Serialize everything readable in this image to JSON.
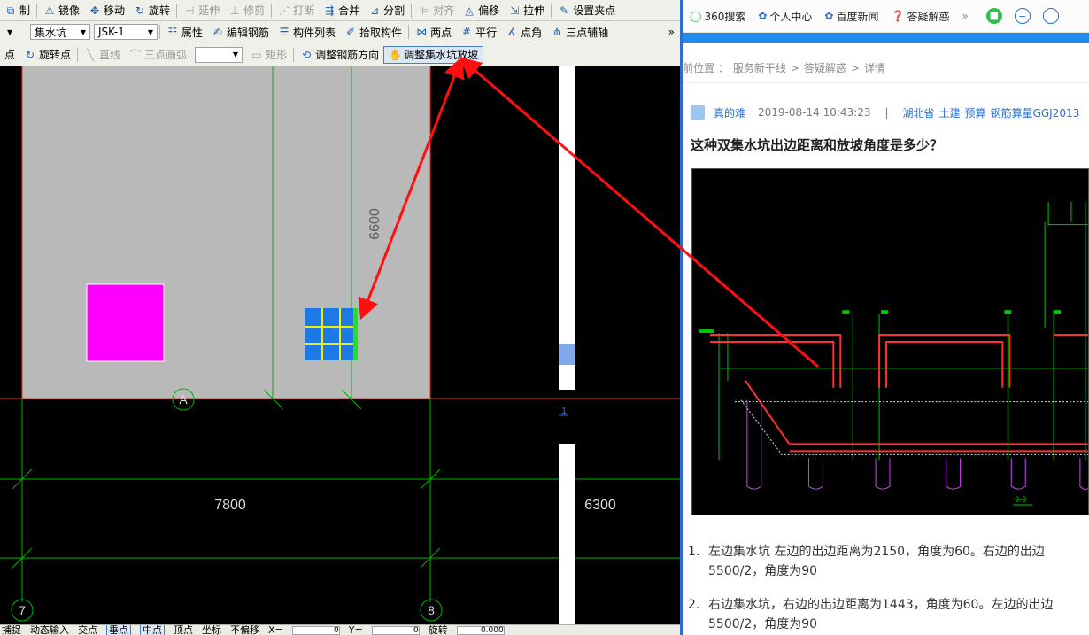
{
  "cad": {
    "toolbar1": {
      "items": [
        {
          "icon": "copy-icon",
          "glyph": "⧉",
          "label": "制",
          "disabled": false
        },
        {
          "icon": "mirror-icon",
          "glyph": "⚠",
          "label": "镜像",
          "disabled": false
        },
        {
          "icon": "move-icon",
          "glyph": "✥",
          "label": "移动",
          "disabled": false
        },
        {
          "icon": "rotate-icon",
          "glyph": "↻",
          "label": "旋转",
          "disabled": false
        },
        {
          "icon": "extend-icon",
          "glyph": "⊣",
          "label": "延伸",
          "disabled": true
        },
        {
          "icon": "trim-icon",
          "glyph": "⊥",
          "label": "修剪",
          "disabled": true
        },
        {
          "icon": "break-icon",
          "glyph": "⋰",
          "label": "打断",
          "disabled": true
        },
        {
          "icon": "merge-icon",
          "glyph": "⇶",
          "label": "合并",
          "disabled": false
        },
        {
          "icon": "split-icon",
          "glyph": "⊿",
          "label": "分割",
          "disabled": false
        },
        {
          "icon": "align-icon",
          "glyph": "⊫",
          "label": "对齐",
          "disabled": true
        },
        {
          "icon": "offset-icon",
          "glyph": "◬",
          "label": "偏移",
          "disabled": false
        },
        {
          "icon": "stretch-icon",
          "glyph": "⇲",
          "label": "拉伸",
          "disabled": false
        },
        {
          "icon": "grip-icon",
          "glyph": "✎",
          "label": "设置夹点",
          "disabled": false
        }
      ]
    },
    "toolbar2": {
      "category": "集水坑",
      "component": "JSK-1",
      "items": [
        {
          "icon": "properties-icon",
          "glyph": "☷",
          "label": "属性"
        },
        {
          "icon": "edit-rebar-icon",
          "glyph": "✍",
          "label": "编辑钢筋"
        },
        {
          "icon": "component-list-icon",
          "glyph": "☰",
          "label": "构件列表"
        },
        {
          "icon": "pick-component-icon",
          "glyph": "✐",
          "label": "拾取构件"
        },
        {
          "icon": "two-point-icon",
          "glyph": "⋈",
          "label": "两点"
        },
        {
          "icon": "parallel-icon",
          "glyph": "#",
          "label": "平行"
        },
        {
          "icon": "point-angle-icon",
          "glyph": "∡",
          "label": "点角"
        },
        {
          "icon": "three-point-aux-icon",
          "glyph": "⋔",
          "label": "三点辅轴"
        }
      ],
      "more": "»"
    },
    "toolbar3": {
      "items": [
        {
          "icon": "point-icon",
          "glyph": "",
          "label": "点",
          "disabled": false
        },
        {
          "icon": "rotate-point-icon",
          "glyph": "↻",
          "label": "旋转点",
          "disabled": false
        },
        {
          "icon": "line-icon",
          "glyph": "╲",
          "label": "直线",
          "disabled": true
        },
        {
          "icon": "arc-icon",
          "glyph": "⌒",
          "label": "三点画弧",
          "disabled": true
        },
        {
          "icon": "rect-icon",
          "glyph": "▭",
          "label": "矩形",
          "disabled": true
        },
        {
          "icon": "rebar-direction-icon",
          "glyph": "⟲",
          "label": "调整钢筋方向",
          "disabled": false
        },
        {
          "icon": "slope-icon",
          "glyph": "✋",
          "label": "调整集水坑放坡",
          "disabled": false,
          "active": true
        }
      ]
    },
    "drawing": {
      "dimension_vertical": "6600",
      "dimension_bottom_left": "7800",
      "dimension_bottom_right": "6300",
      "axis_a": "A",
      "axis_7": "7",
      "axis_8": "8",
      "side_mark": "1",
      "colors": {
        "slab": "#b9b9b9",
        "magenta_pit": "#ff00ff",
        "blue_pit": "#1e78e6",
        "grid": "#00b400",
        "red_line": "#ff2a2a"
      }
    },
    "statusbar": {
      "items": [
        {
          "label": "捕捉",
          "on": false
        },
        {
          "label": "动态输入",
          "on": false
        },
        {
          "label": "交点",
          "on": false
        },
        {
          "label": "垂点",
          "on": true
        },
        {
          "label": "中点",
          "on": true
        },
        {
          "label": "顶点",
          "on": false
        },
        {
          "label": "坐标",
          "on": false
        }
      ],
      "offset_mode": "不偏移",
      "x_label": "X=",
      "x_value": "0",
      "y_label": "Y=",
      "y_value": "0",
      "rotate_label": "旋转",
      "rotate_value": "0.000"
    }
  },
  "browser": {
    "bookmarks": [
      {
        "icon": "360-search-icon",
        "label": "360搜索"
      },
      {
        "icon": "personal-center-icon",
        "label": "个人中心"
      },
      {
        "icon": "baidu-news-icon",
        "label": "百度新闻"
      },
      {
        "icon": "qa-icon",
        "label": "答疑解惑"
      }
    ],
    "more": "»",
    "breadcrumb": {
      "prefix": "前位置 ：",
      "items": [
        "服务新干线",
        "答疑解惑",
        "详情"
      ],
      "sep": ">"
    },
    "meta": {
      "author": "真的难",
      "datetime": "2019-08-14 10:43:23",
      "pipe": "|",
      "region": "湖北省",
      "tags": [
        "土建",
        "预算",
        "钢筋算量GGJ2013"
      ]
    },
    "question_title": "这种双集水坑出边距离和放坡角度是多少？",
    "image_labels": {
      "section": "9-9"
    },
    "answers": [
      {
        "num": "1.",
        "line1": "左边集水坑   左边的出边距离为2150，角度为60。右边的出边",
        "line2": "5500/2，角度为90"
      },
      {
        "num": "2.",
        "line1": "右边集水坑，右边的出边距离为1443，角度为60。左边的出边",
        "line2": "5500/2，角度为90"
      }
    ]
  }
}
